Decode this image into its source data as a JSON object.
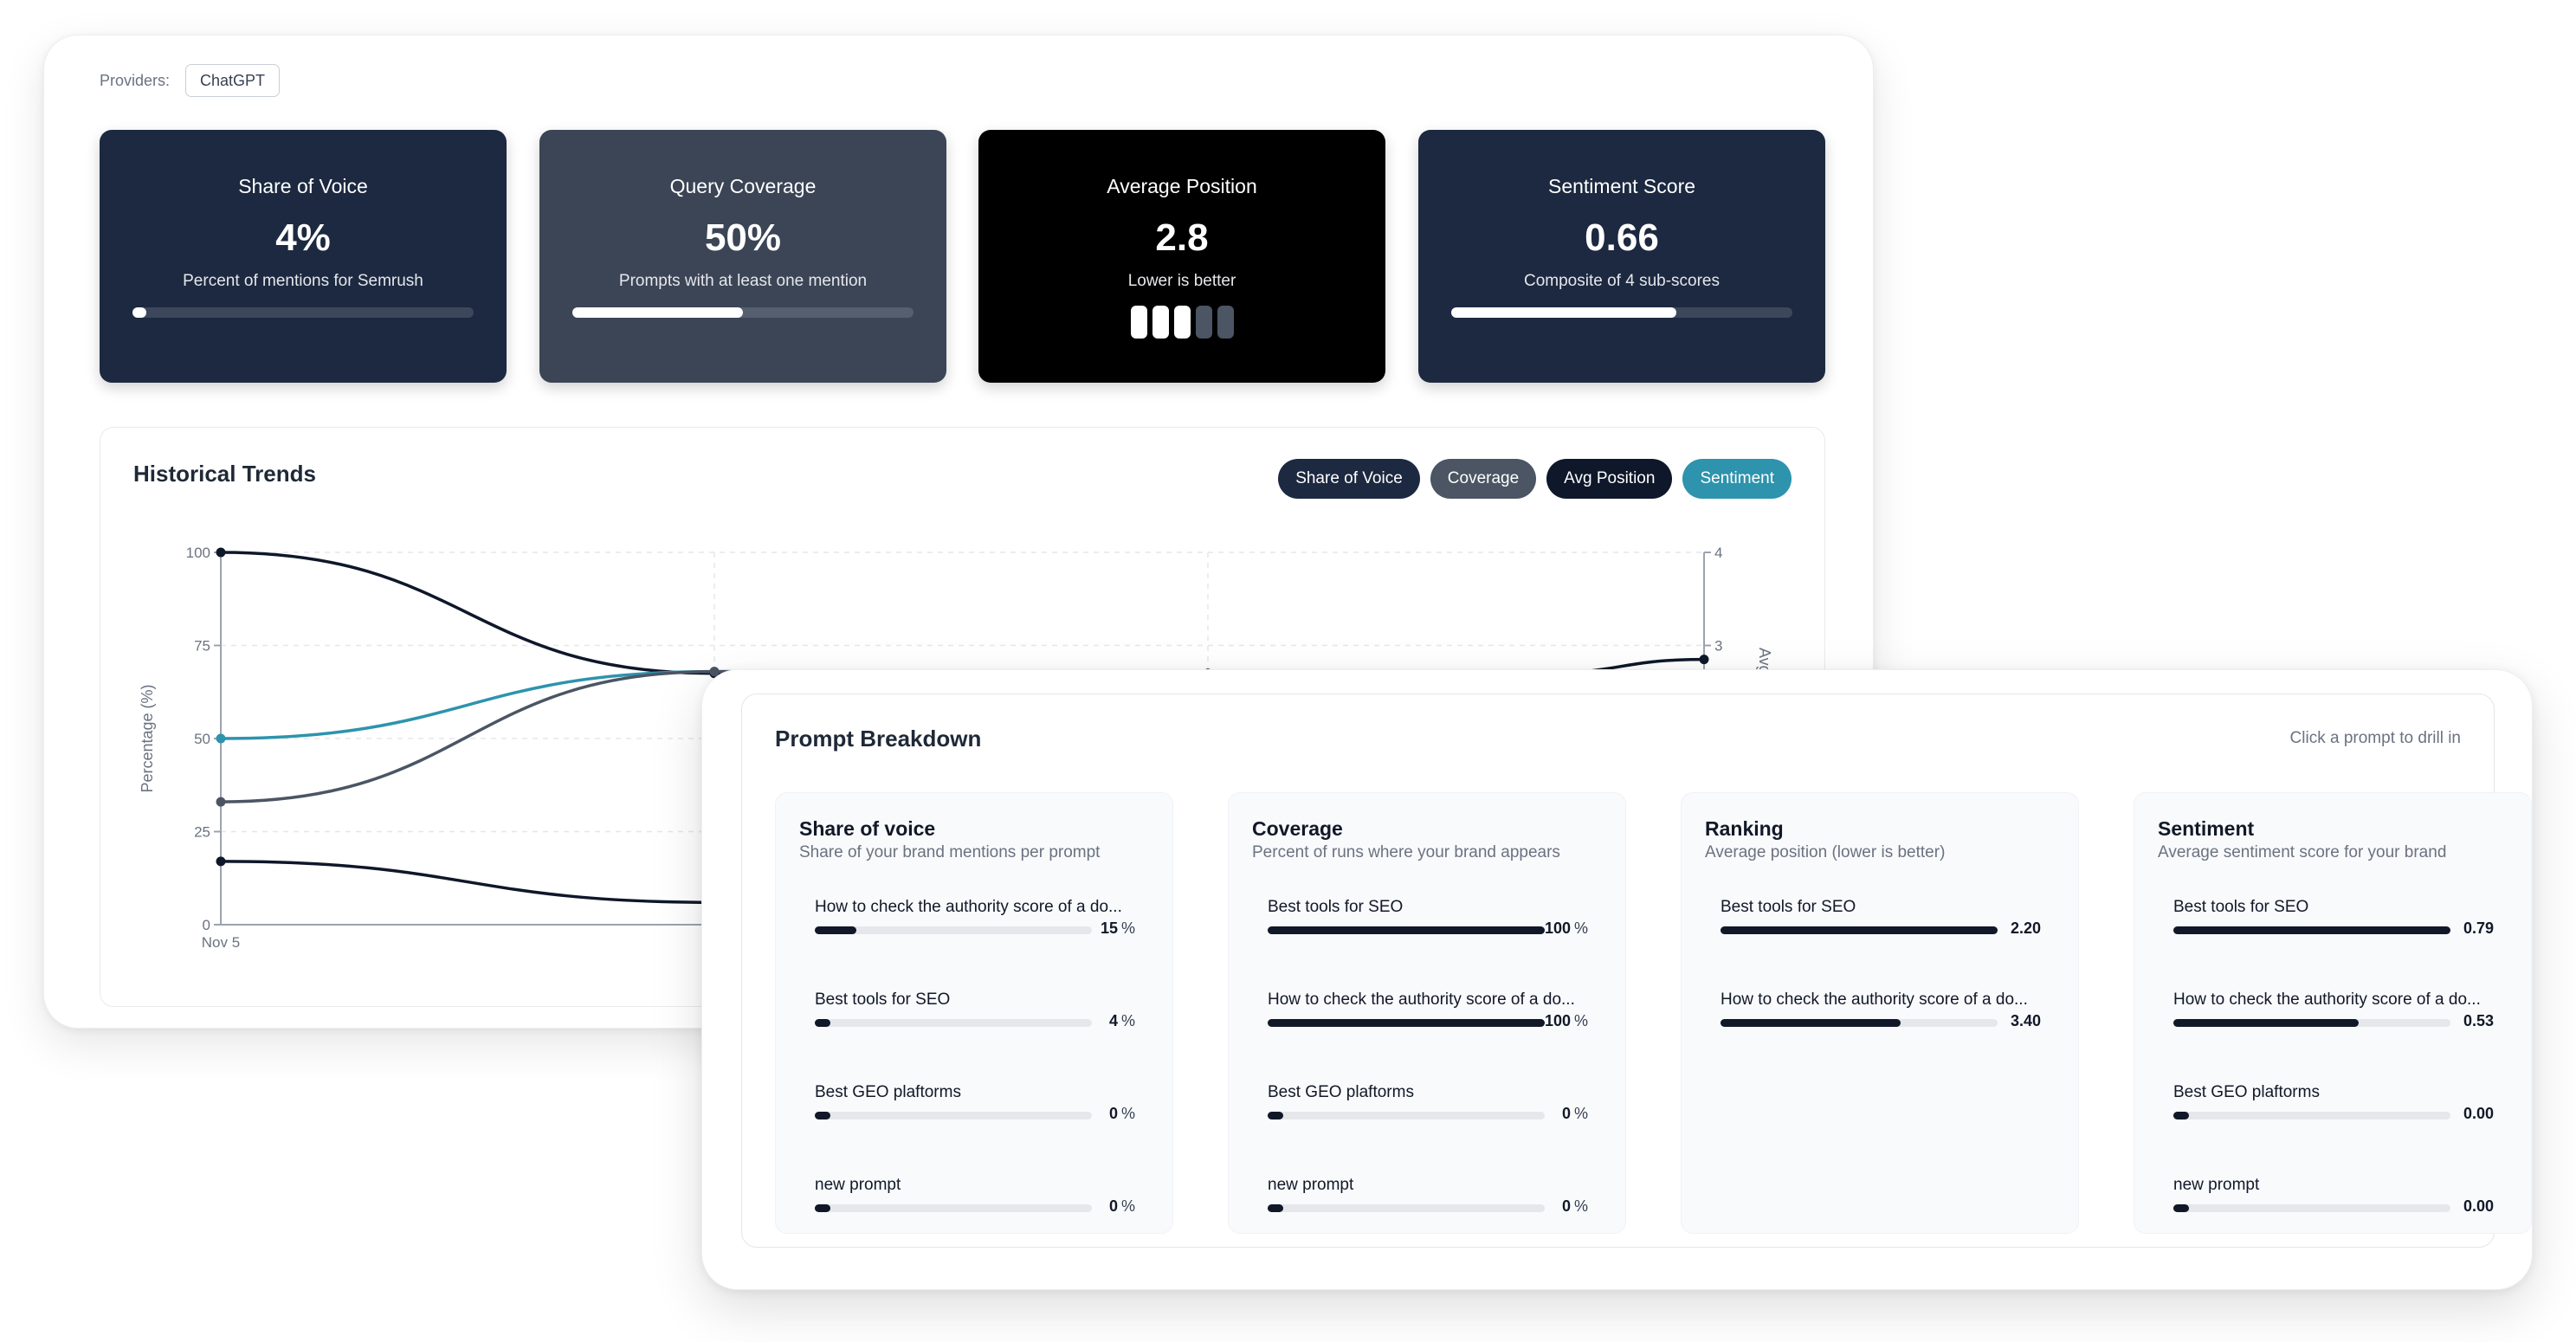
{
  "providers": {
    "label": "Providers:",
    "selected": "ChatGPT"
  },
  "cards": [
    {
      "title": "Share of Voice",
      "value": "4%",
      "subtitle": "Percent of mentions for Semrush",
      "progress": 0.04,
      "bg": "#1c2940"
    },
    {
      "title": "Query Coverage",
      "value": "50%",
      "subtitle": "Prompts with at least one mention",
      "progress": 0.5,
      "bg": "#3b4556"
    },
    {
      "title": "Average Position",
      "value": "2.8",
      "subtitle": "Lower is better",
      "pips_total": 5,
      "pips_on": 3,
      "bg": "#000000"
    },
    {
      "title": "Sentiment Score",
      "value": "0.66",
      "subtitle": "Composite of 4 sub-scores",
      "progress": 0.66,
      "bg": "#1c2940"
    }
  ],
  "trends": {
    "title": "Historical Trends",
    "toggles": [
      {
        "label": "Share of Voice",
        "color": "#1c2940"
      },
      {
        "label": "Coverage",
        "color": "#4b5563"
      },
      {
        "label": "Avg Position",
        "color": "#0f172a"
      },
      {
        "label": "Sentiment",
        "color": "#2e93ad"
      }
    ]
  },
  "chart_data": {
    "type": "line",
    "ylabel": "Percentage (%)",
    "y2label": "Avg",
    "ylim": [
      0,
      100
    ],
    "y2lim": [
      0,
      4
    ],
    "y_ticks": [
      0,
      25,
      50,
      75,
      100
    ],
    "y2_ticks": [
      3,
      4
    ],
    "x_labels": [
      "Nov 5",
      "Nov"
    ],
    "grid": true,
    "series": [
      {
        "color": "#0f172a",
        "axis": "y2",
        "values": [
          4.0,
          2.7,
          2.7,
          2.7,
          2.85
        ]
      },
      {
        "color": "#2e93ad",
        "axis": "y",
        "values": [
          50,
          68,
          68,
          68,
          68
        ]
      },
      {
        "color": "#4b5563",
        "axis": "y",
        "values": [
          33,
          68,
          68,
          68,
          68
        ]
      },
      {
        "color": "#0f172a",
        "axis": "y",
        "values": [
          17,
          6,
          6,
          6,
          6
        ]
      }
    ]
  },
  "breakdown": {
    "title": "Prompt Breakdown",
    "hint": "Click a prompt to drill in",
    "columns": [
      {
        "title": "Share of voice",
        "subtitle": "Share of your brand mentions per prompt",
        "rows": [
          {
            "label": "How to check the authority score of a do...",
            "value": "15",
            "unit": "%",
            "fill": 0.15
          },
          {
            "label": "Best tools for SEO",
            "value": "4",
            "unit": "%",
            "fill": 0.04
          },
          {
            "label": "Best GEO plaftorms",
            "value": "0",
            "unit": "%",
            "fill": 0
          },
          {
            "label": "new prompt",
            "value": "0",
            "unit": "%",
            "fill": 0
          }
        ]
      },
      {
        "title": "Coverage",
        "subtitle": "Percent of runs where your brand appears",
        "rows": [
          {
            "label": "Best tools for SEO",
            "value": "100",
            "unit": "%",
            "fill": 1
          },
          {
            "label": "How to check the authority score of a do...",
            "value": "100",
            "unit": "%",
            "fill": 1
          },
          {
            "label": "Best GEO plaftorms",
            "value": "0",
            "unit": "%",
            "fill": 0
          },
          {
            "label": "new prompt",
            "value": "0",
            "unit": "%",
            "fill": 0
          }
        ]
      },
      {
        "title": "Ranking",
        "subtitle": "Average position (lower is better)",
        "rows": [
          {
            "label": "Best tools for SEO",
            "value": "2.20",
            "unit": "",
            "fill": 1
          },
          {
            "label": "How to check the authority score of a do...",
            "value": "3.40",
            "unit": "",
            "fill": 0.65
          }
        ]
      },
      {
        "title": "Sentiment",
        "subtitle": "Average sentiment score for your brand",
        "rows": [
          {
            "label": "Best tools for SEO",
            "value": "0.79",
            "unit": "",
            "fill": 1
          },
          {
            "label": "How to check the authority score of a do...",
            "value": "0.53",
            "unit": "",
            "fill": 0.67
          },
          {
            "label": "Best GEO plaftorms",
            "value": "0.00",
            "unit": "",
            "fill": 0
          },
          {
            "label": "new prompt",
            "value": "0.00",
            "unit": "",
            "fill": 0
          }
        ]
      }
    ]
  }
}
